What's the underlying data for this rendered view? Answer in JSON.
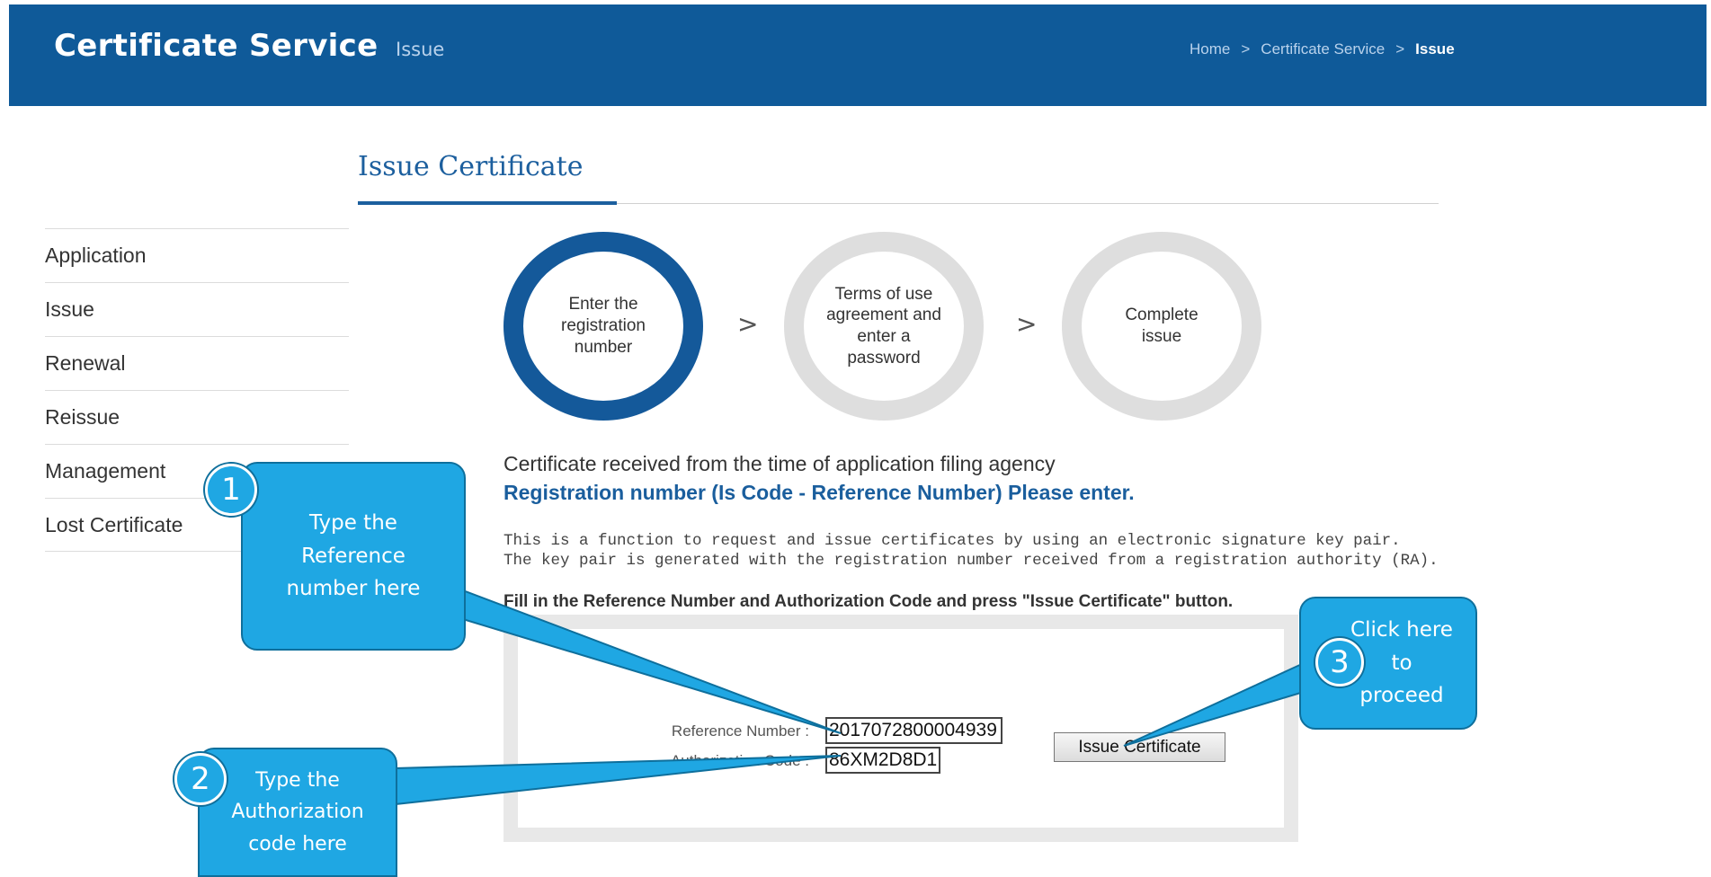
{
  "header": {
    "app_title": "Certificate Service",
    "subtitle": "Issue",
    "breadcrumb": [
      "Home",
      "Certificate Service",
      "Issue"
    ],
    "breadcrumb_sep": ">"
  },
  "page": {
    "title": "Issue Certificate"
  },
  "sidebar": {
    "items": [
      {
        "label": "Application"
      },
      {
        "label": "Issue"
      },
      {
        "label": "Renewal"
      },
      {
        "label": "Reissue"
      },
      {
        "label": "Management"
      },
      {
        "label": "Lost Certificate"
      }
    ]
  },
  "steps": [
    {
      "label": "Enter the registration number",
      "active": true
    },
    {
      "label": "Terms of use agreement and enter a password",
      "active": false
    },
    {
      "label": "Complete issue",
      "active": false
    }
  ],
  "step_arrow": ">",
  "content": {
    "intro_line1": "Certificate received from the time of application filing agency",
    "intro_line2": "Registration number (Is Code - Reference Number) Please enter.",
    "desc_line1": "This is a function to request and issue certificates by using an electronic signature key pair.",
    "desc_line2": "The key pair is generated with the registration number received from a registration authority (RA).",
    "instruction": "Fill in the Reference Number and Authorization Code and press \"Issue Certificate\" button."
  },
  "form": {
    "reference_label": "Reference Number :",
    "reference_value": "2017072800004939",
    "auth_label": "Authorization Code :",
    "auth_value": "86XM2D8D1",
    "issue_button": "Issue Certificate"
  },
  "callouts": [
    {
      "number": "1",
      "text": "Type the Reference number here"
    },
    {
      "number": "2",
      "text": "Type the Authorization code here"
    },
    {
      "number": "3",
      "text": "Click here to proceed"
    }
  ],
  "colors": {
    "header_bg": "#0f5a99",
    "accent": "#1c5f9e",
    "callout": "#1fa7e3"
  }
}
